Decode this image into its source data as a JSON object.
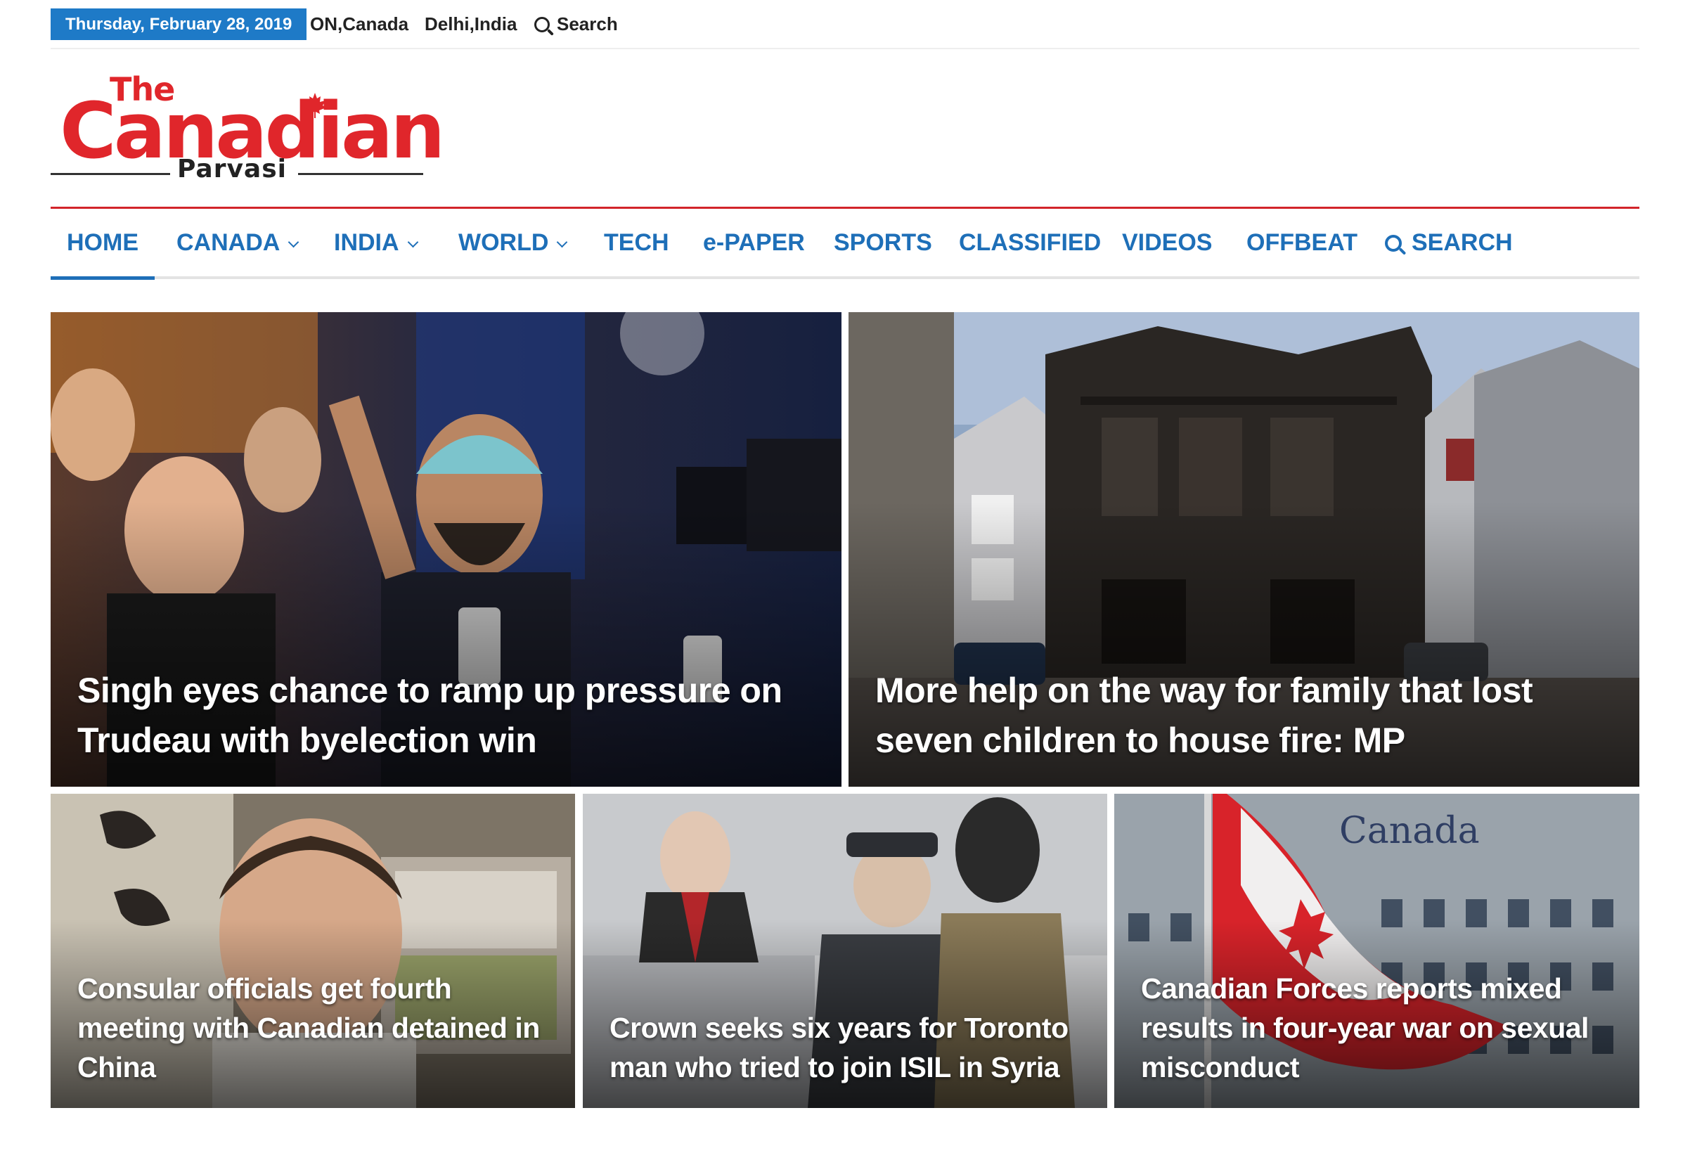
{
  "topbar": {
    "date": "Thursday, February 28, 2019",
    "location1": "ON,Canada",
    "location2": "Delhi,India",
    "search_label": "Search"
  },
  "logo": {
    "the": "The",
    "name": "Canadian",
    "sub": "Parvasi"
  },
  "nav": {
    "items": [
      {
        "label": "HOME",
        "active": true
      },
      {
        "label": "CANADA",
        "dropdown": true
      },
      {
        "label": "INDIA",
        "dropdown": true
      },
      {
        "label": "WORLD",
        "dropdown": true
      },
      {
        "label": "TECH"
      },
      {
        "label": "e-PAPER"
      },
      {
        "label": "SPORTS"
      },
      {
        "label": "CLASSIFIED"
      },
      {
        "label": "VIDEOS"
      },
      {
        "label": "OFFBEAT"
      },
      {
        "label": "SEARCH",
        "icon": "search-icon"
      }
    ]
  },
  "stories": [
    {
      "headline": "Singh eyes chance to ramp up pressure on Trudeau with byelection win"
    },
    {
      "headline": "More help on the way for family that lost seven children to house fire: MP"
    },
    {
      "headline": "Consular officials get fourth meeting with Canadian detained in China"
    },
    {
      "headline": "Crown seeks six years for Toronto man who tried to join ISIL in Syria"
    },
    {
      "headline": "Canadian Forces reports mixed results in four-year war on sexual misconduct"
    }
  ],
  "colors": {
    "brand_red": "#e0262b",
    "nav_blue": "#1e6fb8",
    "date_badge": "#1e7ac7"
  }
}
